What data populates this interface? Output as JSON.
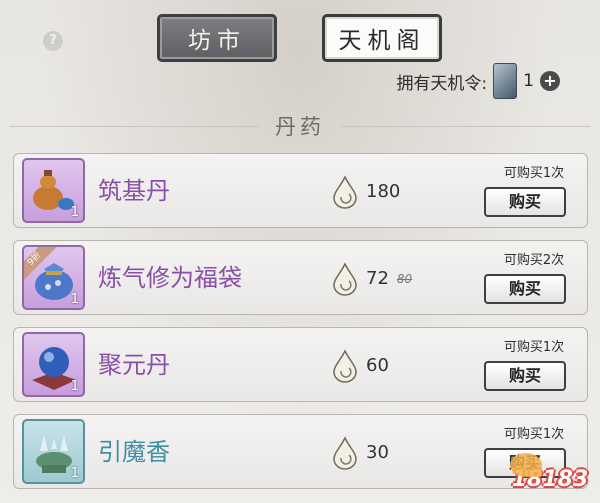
{
  "tabs": [
    {
      "label": "坊市",
      "active": false
    },
    {
      "label": "天机阁",
      "active": true
    }
  ],
  "token": {
    "label": "拥有天机令:",
    "count": "1",
    "icon": "tianji-token-icon"
  },
  "section_title": "丹药",
  "items": [
    {
      "name": "筑基丹",
      "price": "180",
      "old_price": "",
      "limit": "可购买1次",
      "buy": "购买",
      "qty": "1",
      "badge": "",
      "icon": "gourd-icon"
    },
    {
      "name": "炼气修为福袋",
      "price": "72",
      "old_price": "80",
      "limit": "可购买2次",
      "buy": "购买",
      "qty": "1",
      "badge": "9折",
      "icon": "pouch-icon"
    },
    {
      "name": "聚元丹",
      "price": "60",
      "old_price": "",
      "limit": "可购买1次",
      "buy": "购买",
      "qty": "1",
      "badge": "",
      "icon": "orb-icon"
    },
    {
      "name": "引魔香",
      "price": "30",
      "old_price": "",
      "limit": "可购买1次",
      "buy": "购买",
      "qty": "1",
      "badge": "",
      "icon": "incense-icon"
    }
  ],
  "watermark": "18183",
  "colors": {
    "purple_name": "#8a4fa6",
    "teal_name": "#3e8fa3",
    "purple_frame": "#c79edd",
    "teal_frame": "#9ccad2"
  }
}
